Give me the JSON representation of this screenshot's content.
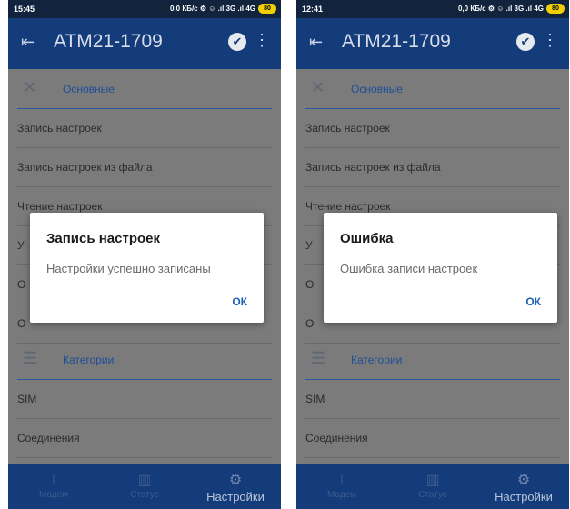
{
  "screens": [
    {
      "status": {
        "time": "15:45",
        "right": "0,0 КБ/с ⚙ ☺ .ıl 3G .ıl 4G",
        "battery": "80"
      },
      "appbar": {
        "title": "ATM21-1709"
      },
      "sections": {
        "main": "Основные",
        "categories": "Категории"
      },
      "rows": [
        "Запись настроек",
        "Запись настроек из файла",
        "Чтение настроек",
        "У",
        "О",
        "О",
        "SIM",
        "Соединения"
      ],
      "nav": [
        {
          "label": "Модем"
        },
        {
          "label": "Статус"
        },
        {
          "label": "Настройки"
        }
      ],
      "dialog": {
        "title": "Запись настроек",
        "message": "Настройки успешно записаны",
        "ok": "ОК"
      }
    },
    {
      "status": {
        "time": "12:41",
        "right": "0,0 КБ/с ⚙ ☺ .ıl 3G .ıl 4G",
        "battery": "80"
      },
      "appbar": {
        "title": "ATM21-1709"
      },
      "sections": {
        "main": "Основные",
        "categories": "Категории"
      },
      "rows": [
        "Запись настроек",
        "Запись настроек из файла",
        "Чтение настроек",
        "У",
        "О",
        "О",
        "SIM",
        "Соединения"
      ],
      "nav": [
        {
          "label": "Модем"
        },
        {
          "label": "Статус"
        },
        {
          "label": "Настройки"
        }
      ],
      "dialog": {
        "title": "Ошибка",
        "message": "Ошибка записи настроек",
        "ok": "ОК"
      }
    }
  ],
  "icons": {
    "back": "exit-arrow-icon",
    "check": "check-circle-icon",
    "more": "more-vert-icon",
    "main_section": "tools-icon",
    "categories_section": "sliders-icon",
    "nav_modem": "modem-icon",
    "nav_status": "bar-chart-icon",
    "nav_settings": "gear-icon"
  },
  "colors": {
    "appbar": "#143b7a",
    "accent": "#1f5fb4",
    "statusbar": "#12233d"
  }
}
